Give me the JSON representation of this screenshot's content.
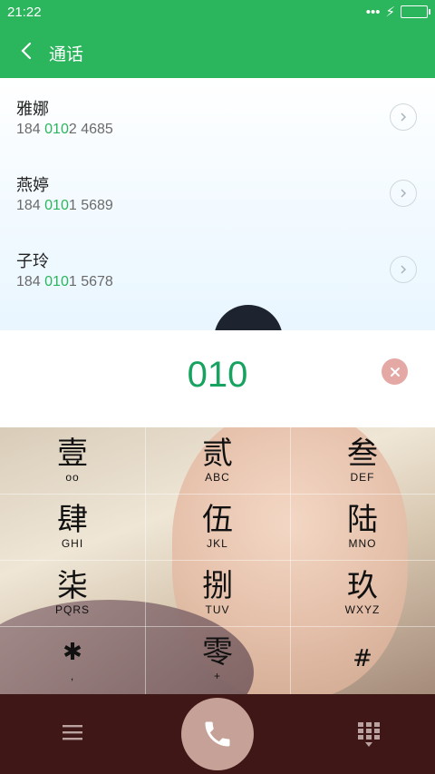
{
  "status_bar": {
    "time": "21:22",
    "dots": "•••",
    "charging": "⚡"
  },
  "header": {
    "title": "通话"
  },
  "contacts": [
    {
      "name": "雅娜",
      "number_pre": "184 ",
      "number_match": "010",
      "number_post": "2 4685"
    },
    {
      "name": "燕婷",
      "number_pre": "184 ",
      "number_match": "010",
      "number_post": "1 5689"
    },
    {
      "name": "子玲",
      "number_pre": "184 ",
      "number_match": "010",
      "number_post": "1 5678"
    }
  ],
  "dial_input": {
    "value": "010"
  },
  "keypad": {
    "keys": [
      {
        "glyph": "壹",
        "sub": "ᴏᴏ"
      },
      {
        "glyph": "贰",
        "sub": "ABC"
      },
      {
        "glyph": "叁",
        "sub": "DEF"
      },
      {
        "glyph": "肆",
        "sub": "GHI"
      },
      {
        "glyph": "伍",
        "sub": "JKL"
      },
      {
        "glyph": "陆",
        "sub": "MNO"
      },
      {
        "glyph": "柒",
        "sub": "PQRS"
      },
      {
        "glyph": "捌",
        "sub": "TUV"
      },
      {
        "glyph": "玖",
        "sub": "WXYZ"
      },
      {
        "glyph": "✱",
        "sub": ","
      },
      {
        "glyph": "零",
        "sub": "+"
      },
      {
        "glyph": "#",
        "sub": ""
      }
    ]
  },
  "colors": {
    "accent": "#2bb55c",
    "number_match": "#2bb55c",
    "bottom_bar": "#3f1717",
    "call_button": "#c5a197"
  },
  "icons": {
    "back": "chevron-left-icon",
    "contact_detail": "chevron-right-icon",
    "clear": "close-icon",
    "menu": "hamburger-menu-icon",
    "call": "phone-icon",
    "dialpad": "dialpad-icon"
  }
}
